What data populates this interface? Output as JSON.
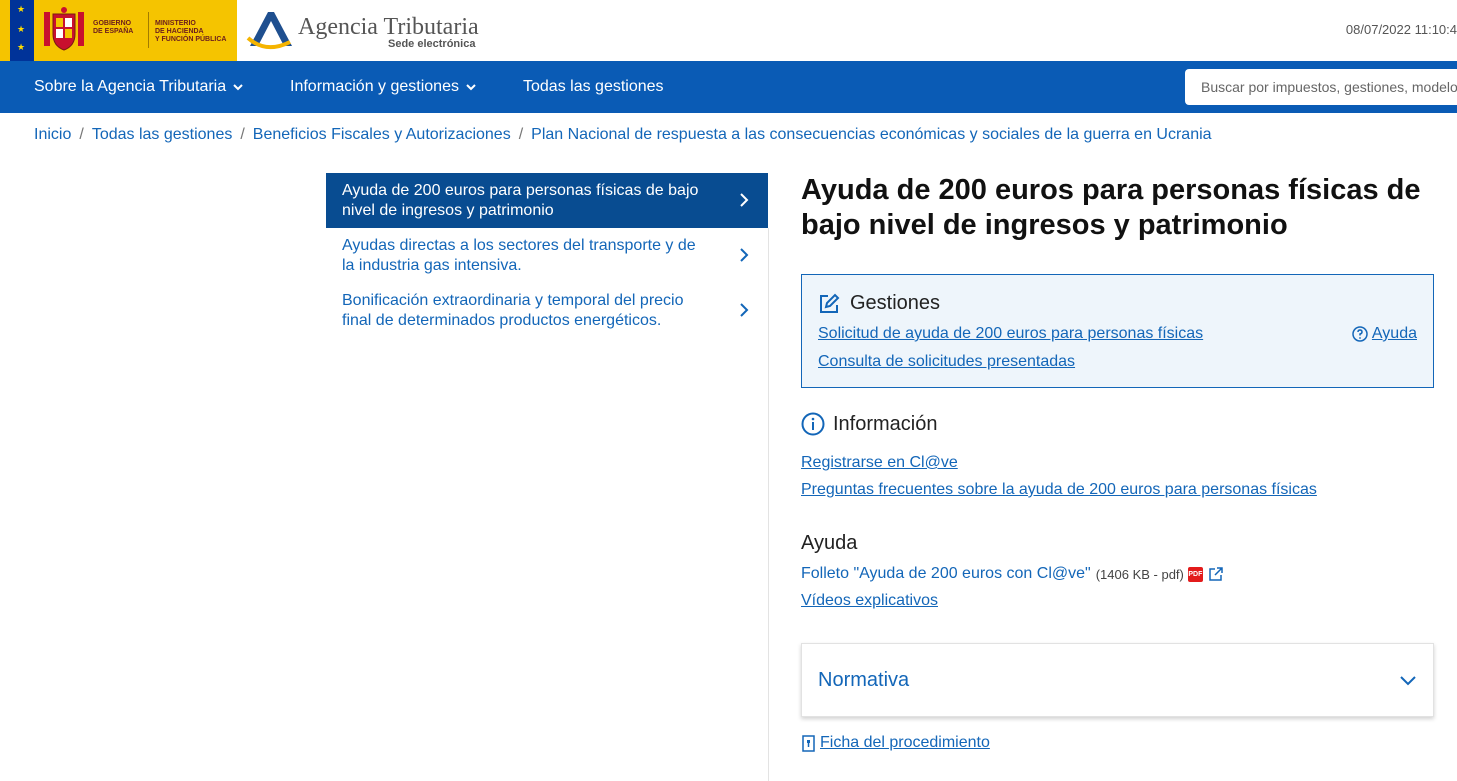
{
  "header": {
    "gov_line1": "GOBIERNO",
    "gov_line2": "DE ESPAÑA",
    "ministry_line1": "MINISTERIO",
    "ministry_line2": "DE HACIENDA",
    "ministry_line3": "Y FUNCIÓN PÚBLICA",
    "agency_title": "Agencia Tributaria",
    "agency_subtitle": "Sede electrónica",
    "datetime": "08/07/2022 11:10:4"
  },
  "nav": {
    "items": [
      {
        "label": "Sobre la Agencia Tributaria",
        "has_dropdown": true
      },
      {
        "label": "Información y gestiones",
        "has_dropdown": true
      },
      {
        "label": "Todas las gestiones",
        "has_dropdown": false
      }
    ],
    "search_placeholder": "Buscar por impuestos, gestiones, modelos"
  },
  "breadcrumb": [
    "Inicio",
    "Todas las gestiones",
    "Beneficios Fiscales y Autorizaciones",
    "Plan Nacional de respuesta a las consecuencias económicas y sociales de la guerra en Ucrania"
  ],
  "sidemenu": [
    {
      "label": "Ayuda de 200 euros para personas físicas de bajo nivel de ingresos y patrimonio",
      "active": true
    },
    {
      "label": "Ayudas directas a los sectores del transporte y de la industria gas intensiva.",
      "active": false
    },
    {
      "label": "Bonificación extraordinaria y temporal del precio final de determinados productos energéticos.",
      "active": false
    }
  ],
  "main": {
    "title": "Ayuda de 200 euros para personas físicas de bajo nivel de ingresos y patrimonio",
    "gestiones": {
      "heading": "Gestiones",
      "links": [
        "Solicitud de ayuda de 200 euros para personas físicas",
        "Consulta de solicitudes presentadas"
      ],
      "help_label": "Ayuda"
    },
    "informacion": {
      "heading": "Información",
      "links": [
        "Registrarse en Cl@ve",
        "Preguntas frecuentes sobre la ayuda de 200 euros para personas físicas"
      ]
    },
    "ayuda": {
      "heading": "Ayuda",
      "folleto_label": "Folleto \"Ayuda de 200 euros con Cl@ve\"",
      "folleto_meta": "(1406 KB - pdf)",
      "pdf_badge": "PDF",
      "videos_label": "Vídeos explicativos"
    },
    "normativa_label": "Normativa",
    "ficha_label": "Ficha del procedimiento"
  },
  "colors": {
    "nav_blue": "#0a5bb5",
    "active_menu": "#084c91",
    "link_blue": "#1366b8",
    "gov_yellow": "#f5c400"
  }
}
